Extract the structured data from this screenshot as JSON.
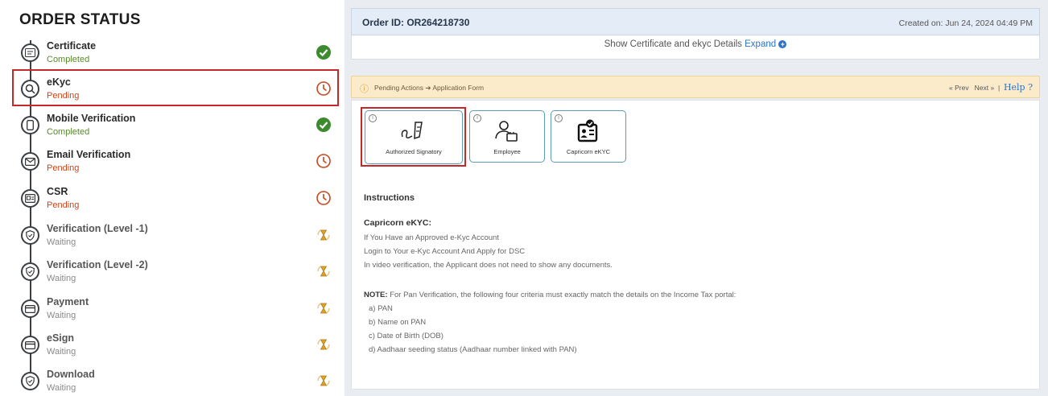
{
  "left": {
    "title": "ORDER STATUS",
    "steps": [
      {
        "title": "Certificate",
        "status": "Completed"
      },
      {
        "title": "eKyc",
        "status": "Pending"
      },
      {
        "title": "Mobile Verification",
        "status": "Completed"
      },
      {
        "title": "Email Verification",
        "status": "Pending"
      },
      {
        "title": "CSR",
        "status": "Pending"
      },
      {
        "title": "Verification (Level -1)",
        "status": "Waiting"
      },
      {
        "title": "Verification (Level -2)",
        "status": "Waiting"
      },
      {
        "title": "Payment",
        "status": "Waiting"
      },
      {
        "title": "eSign",
        "status": "Waiting"
      },
      {
        "title": "Download",
        "status": "Waiting"
      }
    ]
  },
  "header": {
    "order_id": "Order ID: OR264218730",
    "created": "Created on: Jun 24, 2024 04:49 PM",
    "show_text": "Show Certificate and ekyc Details",
    "expand": "Expand"
  },
  "pending_bar": {
    "text": "Pending Actions ➔ Application Form",
    "prev": "« Prev",
    "next": "Next »",
    "separator": "|",
    "help": "Help ?"
  },
  "cards": [
    {
      "label": "Authorized Signatory"
    },
    {
      "label": "Employee"
    },
    {
      "label": "Capricorn eKYC"
    }
  ],
  "instructions": {
    "heading": "Instructions",
    "sub_heading": "Capricorn eKYC:",
    "lines": [
      "If You Have an Approved e-Kyc Account",
      "Login to Your e-Kyc Account And Apply for DSC",
      "In video verification, the Applicant does not need to show any documents."
    ],
    "note_label": "NOTE:",
    "note_text": " For Pan Verification, the following four criteria must exactly match the details on the Income Tax portal:",
    "criteria": [
      "a) PAN",
      "b) Name on PAN",
      "c) Date of Birth (DOB)",
      "d) Aadhaar seeding status (Aadhaar number linked with PAN)"
    ]
  },
  "colors": {
    "completed": "#3d8b2e",
    "pending": "#c8471c",
    "waiting": "#e0a227",
    "highlight": "#c62828",
    "link": "#2b73c9"
  }
}
